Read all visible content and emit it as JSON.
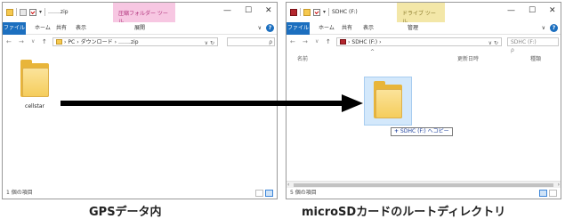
{
  "left": {
    "title": "…….zip",
    "tool_tab": "圧縮フォルダー ツール",
    "tabs": [
      "ファイル",
      "ホーム",
      "共有",
      "表示",
      "展開"
    ],
    "address": [
      "PC",
      "ダウンロード",
      "…….zip"
    ],
    "folder_name": "cellstar",
    "status": "1 個の項目"
  },
  "right": {
    "title": "SDHC (F:)",
    "tool_tab": "ドライブ ツール",
    "tabs": [
      "ファイル",
      "ホーム",
      "共有",
      "表示",
      "管理"
    ],
    "address": [
      "SDHC (F:)"
    ],
    "search_placeholder": "SDHC (F:)　　　　　ρ",
    "col_name": "名前",
    "col_date": "更新日時",
    "col_type": "種類",
    "copy_tooltip": "SDHC (F:) へコピー",
    "status": "5 個の項目"
  },
  "captions": {
    "left": "GPSデータ内",
    "right": "microSDカードのルートディレクトリ"
  },
  "colors": {
    "accent": "#1c6fbf",
    "compress_tab": "#f7c7e2",
    "drive_tab": "#f3e7a8",
    "arrow": "#000000"
  },
  "icons": [
    "folder-icon",
    "check-icon",
    "sd-icon",
    "minimize-icon",
    "maximize-icon",
    "close-icon",
    "help-icon",
    "search-icon",
    "refresh-icon"
  ]
}
